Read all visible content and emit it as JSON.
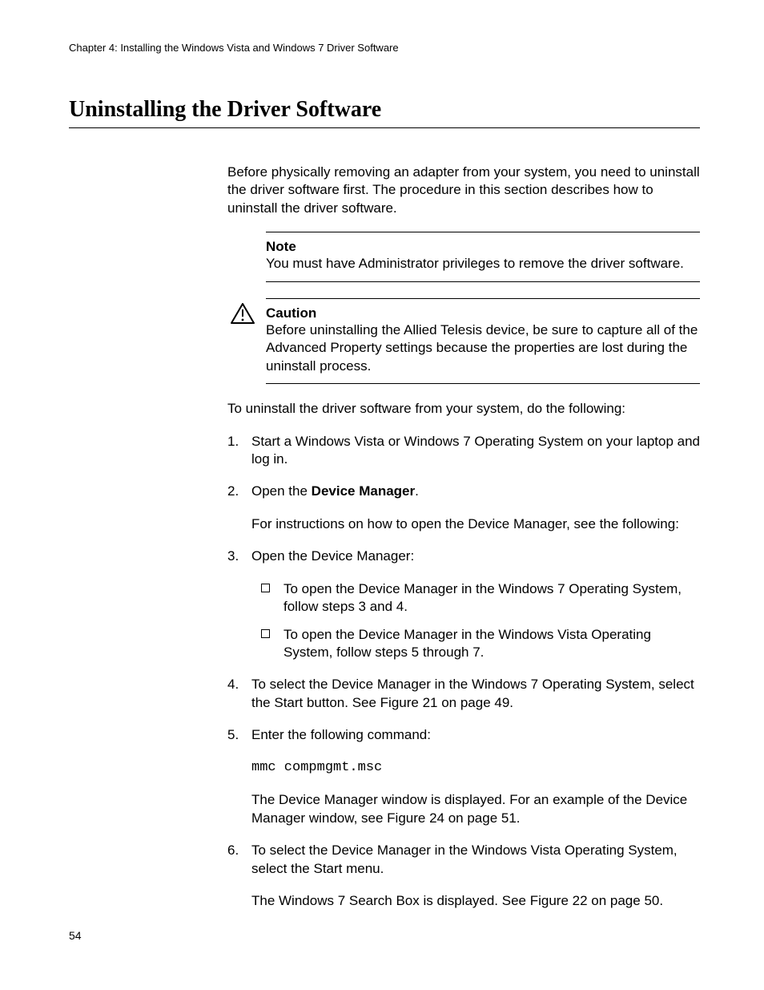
{
  "header": {
    "running": "Chapter 4: Installing the Windows Vista and Windows 7 Driver Software"
  },
  "title": "Uninstalling the Driver Software",
  "intro": "Before physically removing an adapter from your system, you need to uninstall the driver software first. The procedure in this section describes how to uninstall the driver software.",
  "note": {
    "label": "Note",
    "body": "You must have Administrator privileges to remove the driver software."
  },
  "caution": {
    "label": "Caution",
    "body": "Before uninstalling the Allied Telesis device, be sure to capture all of the Advanced Property settings because the properties are lost during the uninstall process."
  },
  "lead": "To uninstall the driver software from your system, do the following:",
  "steps": {
    "s1": "Start a Windows Vista or Windows 7 Operating System on your laptop and log in.",
    "s2_pre": "Open the ",
    "s2_bold": "Device Manager",
    "s2_post": ".",
    "s2_sub": "For instructions on how to open the Device Manager, see the following:",
    "s3": "Open the Device Manager:",
    "s3_b1": "To open the Device Manager in the Windows 7 Operating System, follow steps 3 and 4.",
    "s3_b2": "To open the Device Manager in the Windows Vista Operating System, follow steps 5 through 7.",
    "s4": "To select the Device Manager in the Windows 7 Operating System, select the Start button. See Figure 21 on page 49.",
    "s5": "Enter the following command:",
    "s5_cmd": "mmc compmgmt.msc",
    "s5_sub": "The Device Manager window is displayed. For an example of the Device Manager window, see Figure 24 on page 51.",
    "s6": "To select the Device Manager in the Windows Vista Operating System, select the Start menu.",
    "s6_sub": "The Windows 7 Search Box is displayed. See Figure 22 on page 50."
  },
  "page_number": "54"
}
